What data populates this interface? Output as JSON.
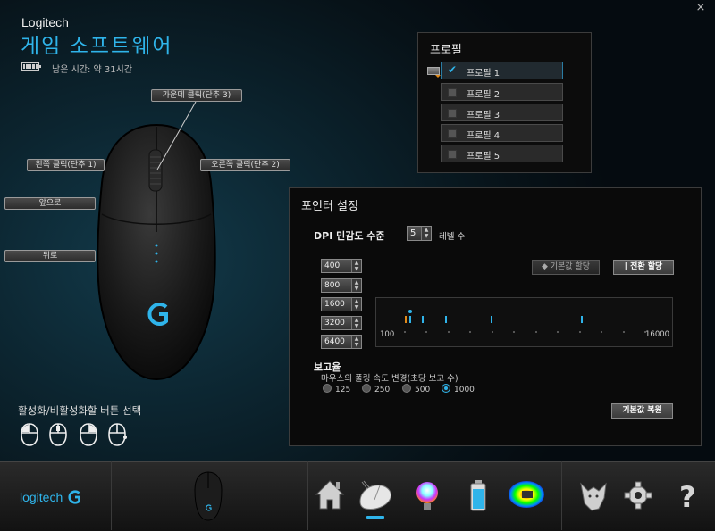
{
  "window": {
    "close_glyph": "×"
  },
  "header": {
    "brand": "Logitech",
    "app_title": "게임 소프트웨어",
    "battery_icon": "battery-icon",
    "battery_text": "남은 시간: 약 31시간"
  },
  "mouse_buttons": {
    "middle": "가운데 클릭(단추 3)",
    "left": "왼쪽 클릭(단추 1)",
    "right": "오른쪽 클릭(단추 2)",
    "forward": "앞으로",
    "back": "뒤로"
  },
  "button_select": {
    "title": "활성화/비활성화할 버튼 선택"
  },
  "profiles": {
    "title": "프로필",
    "items": [
      {
        "label": "프로필 1",
        "checked": true
      },
      {
        "label": "프로필 2",
        "checked": false
      },
      {
        "label": "프로필 3",
        "checked": false
      },
      {
        "label": "프로필 4",
        "checked": false
      },
      {
        "label": "프로필 5",
        "checked": false
      }
    ]
  },
  "pointer": {
    "title": "포인터 설정",
    "dpi_label": "DPI 민감도 수준",
    "level_count": "5",
    "level_label": "레벨 수",
    "dpi_levels": [
      "400",
      "800",
      "1600",
      "3200",
      "6400"
    ],
    "default_shift": "◆ 기본값 할당",
    "switch_shift": "| 전환 할당",
    "slider_min": "100",
    "slider_max": "16000",
    "report_title": "보고율",
    "report_desc": "마우스의 폴링 속도 변경(초당 보고 수)",
    "report_rates": [
      "125",
      "250",
      "500",
      "1000"
    ],
    "report_selected": "1000",
    "restore": "기본값 복원"
  },
  "bottom": {
    "logo_text": "logitech",
    "nav": [
      "home-icon",
      "pointer-settings-icon",
      "lighting-icon",
      "battery-status-icon",
      "heatmap-icon",
      "arx-wolf-icon",
      "settings-gear-icon",
      "help-icon"
    ]
  },
  "colors": {
    "accent": "#2fb4ea",
    "orange": "#e08a1a"
  }
}
